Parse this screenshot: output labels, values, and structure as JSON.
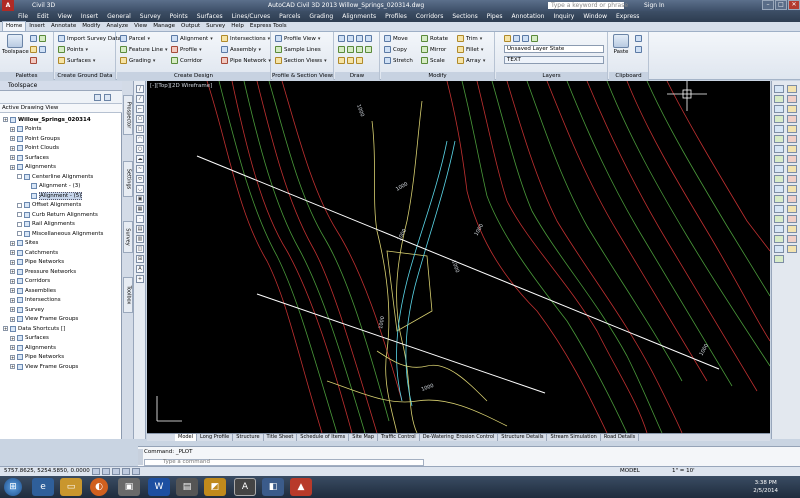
{
  "title_bar": {
    "app_menu_label": "Civil 3D",
    "title": "AutoCAD Civil 3D 2013    Willow_Springs_020314.dwg",
    "search_placeholder": "Type a keyword or phrase",
    "sign_in": "Sign In"
  },
  "menubar": [
    "File",
    "Edit",
    "View",
    "Insert",
    "General",
    "Survey",
    "Points",
    "Surfaces",
    "Lines/Curves",
    "Parcels",
    "Grading",
    "Alignments",
    "Profiles",
    "Corridors",
    "Sections",
    "Pipes",
    "Annotation",
    "Inquiry",
    "Window",
    "Express"
  ],
  "ribbon_tabs": [
    "Home",
    "Insert",
    "Annotate",
    "Modify",
    "Analyze",
    "View",
    "Manage",
    "Output",
    "Survey",
    "Help",
    "Express Tools"
  ],
  "ribbon_active_tab": "Home",
  "ribbon": {
    "toolspace": "Toolspace",
    "palettes_title": "Palettes",
    "ground_data": {
      "title": "Create Ground Data",
      "import": "Import Survey Data",
      "points": "Points",
      "surfaces": "Surfaces"
    },
    "design": {
      "title": "Create Design",
      "parcel": "Parcel",
      "feature_line": "Feature Line",
      "grading": "Grading",
      "alignment": "Alignment",
      "profile": "Profile",
      "corridor": "Corridor",
      "intersections": "Intersections",
      "assembly": "Assembly",
      "pipe_network": "Pipe Network"
    },
    "views": {
      "title": "Profile & Section Views",
      "profile_view": "Profile View",
      "sample_lines": "Sample Lines",
      "section_views": "Section Views"
    },
    "draw": {
      "title": "Draw"
    },
    "modify": {
      "title": "Modify",
      "move": "Move",
      "copy": "Copy",
      "stretch": "Stretch",
      "rotate": "Rotate",
      "mirror": "Mirror",
      "scale": "Scale",
      "trim": "Trim",
      "fillet": "Fillet",
      "array": "Array"
    },
    "layers": {
      "title": "Layers",
      "state": "Unsaved Layer State",
      "current": "TEXT"
    },
    "clipboard": {
      "title": "Clipboard",
      "paste": "Paste"
    }
  },
  "toolspace": {
    "header": "Toolspace",
    "view_selector": "Active Drawing View",
    "tree": [
      {
        "label": "Willow_Springs_020314",
        "level": 0,
        "bold": true
      },
      {
        "label": "Points",
        "level": 1
      },
      {
        "label": "Point Groups",
        "level": 1
      },
      {
        "label": "Point Clouds",
        "level": 1
      },
      {
        "label": "Surfaces",
        "level": 1
      },
      {
        "label": "Alignments",
        "level": 1
      },
      {
        "label": "Centerline Alignments",
        "level": 2
      },
      {
        "label": "Alignment - (3)",
        "level": 3
      },
      {
        "label": "Alignment - (5)",
        "level": 3,
        "selected": true
      },
      {
        "label": "Offset Alignments",
        "level": 2
      },
      {
        "label": "Curb Return Alignments",
        "level": 2
      },
      {
        "label": "Rail Alignments",
        "level": 2
      },
      {
        "label": "Miscellaneous Alignments",
        "level": 2
      },
      {
        "label": "Sites",
        "level": 1
      },
      {
        "label": "Catchments",
        "level": 1
      },
      {
        "label": "Pipe Networks",
        "level": 1
      },
      {
        "label": "Pressure Networks",
        "level": 1
      },
      {
        "label": "Corridors",
        "level": 1
      },
      {
        "label": "Assemblies",
        "level": 1
      },
      {
        "label": "Intersections",
        "level": 1
      },
      {
        "label": "Survey",
        "level": 1
      },
      {
        "label": "View Frame Groups",
        "level": 1
      },
      {
        "label": "Data Shortcuts []",
        "level": 0
      },
      {
        "label": "Surfaces",
        "level": 1
      },
      {
        "label": "Alignments",
        "level": 1
      },
      {
        "label": "Pipe Networks",
        "level": 1
      },
      {
        "label": "View Frame Groups",
        "level": 1
      }
    ]
  },
  "side_tabs": [
    "Prospector",
    "Settings",
    "Survey",
    "Toolbox"
  ],
  "viewport_label": "[-][Top][2D Wireframe]",
  "layout_tabs": [
    "Model",
    "Long Profile",
    "Structure",
    "Title Sheet",
    "Schedule of Items",
    "Site Map",
    "Traffic Control",
    "De-Watering_Erosion Control",
    "Structure Details",
    "Stream Simulation",
    "Road Details"
  ],
  "layout_active": "Model",
  "command_line": {
    "last": "Command: _PLOT",
    "placeholder": "Type a command"
  },
  "status_bar": {
    "coords": "5757.8625, 5254.5850, 0.0000",
    "model": "MODEL",
    "scale": "1\" = 10'"
  },
  "clock": {
    "time": "3:38 PM",
    "date": "2/5/2014"
  },
  "drawing_labels": [
    "1000",
    "1000",
    "1000",
    "1000",
    "1000",
    "1000",
    "1000",
    "1000"
  ],
  "colors": {
    "background": "#000000",
    "contour_red": "#c03030",
    "contour_green": "#4a9a3a",
    "contour_yellow": "#d8d070",
    "alignment": "#ffffff",
    "cyan": "#5ad6e8"
  }
}
